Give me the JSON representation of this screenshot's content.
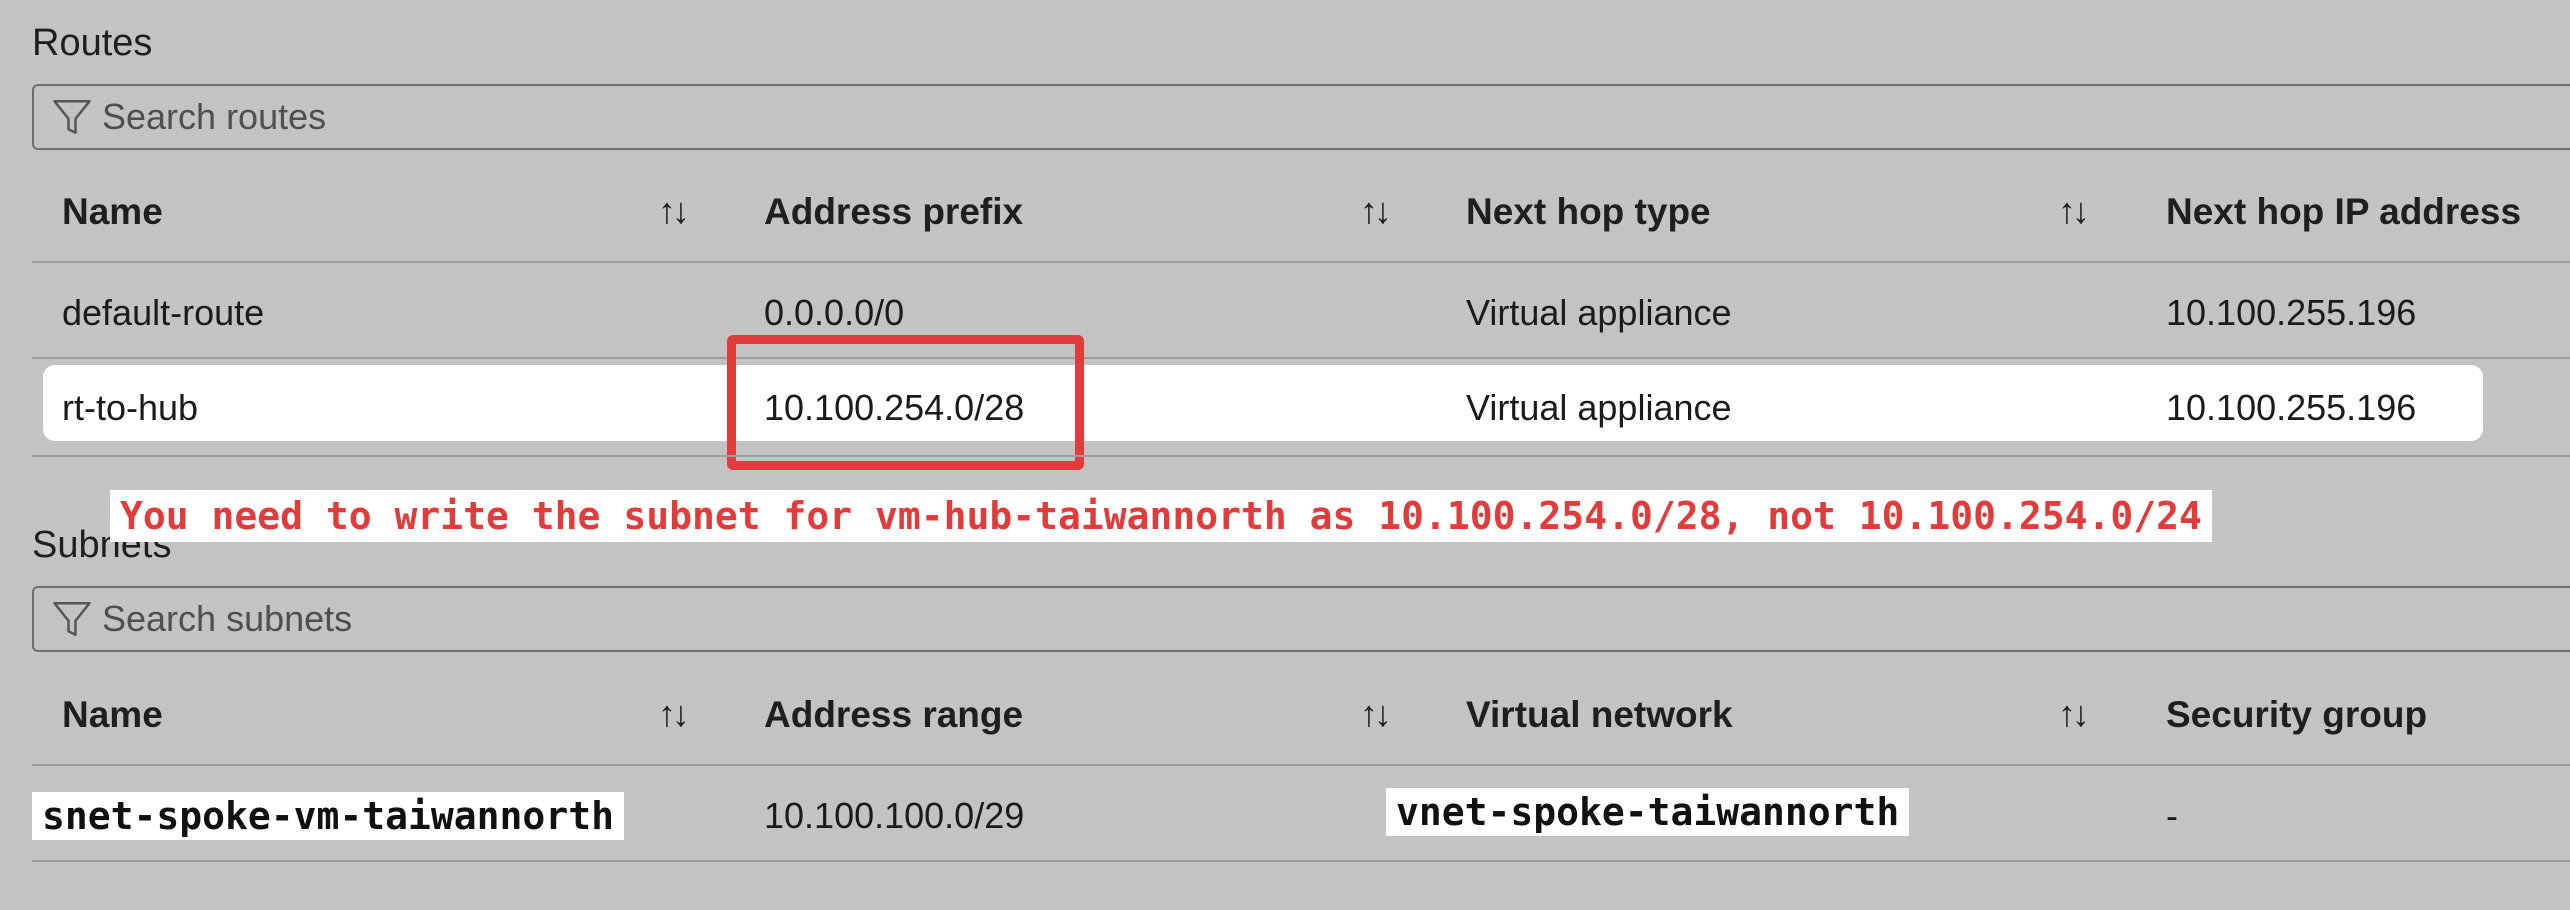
{
  "routes": {
    "title": "Routes",
    "search_placeholder": "Search routes",
    "columns": [
      "Name",
      "Address prefix",
      "Next hop type",
      "Next hop IP address"
    ],
    "rows": [
      [
        "default-route",
        "0.0.0.0/0",
        "Virtual appliance",
        "10.100.255.196"
      ],
      [
        "rt-to-hub",
        "10.100.254.0/28",
        "Virtual appliance",
        "10.100.255.196"
      ]
    ]
  },
  "annotation": {
    "note": "You need to write the subnet for vm-hub-taiwannorth as 10.100.254.0/28, not 10.100.254.0/24",
    "highlight_color": "#e03c3c"
  },
  "subnets": {
    "title": "Subnets",
    "search_placeholder": "Search subnets",
    "columns": [
      "Name",
      "Address range",
      "Virtual network",
      "Security group"
    ],
    "rows": [
      [
        "snet-spoke-vm-taiwannorth",
        "10.100.100.0/29",
        "vnet-spoke-taiwannorth",
        "-"
      ]
    ]
  },
  "icons": {
    "filter": "filter-icon",
    "sort": "sort-icon",
    "sort_glyph": "↑↓"
  }
}
